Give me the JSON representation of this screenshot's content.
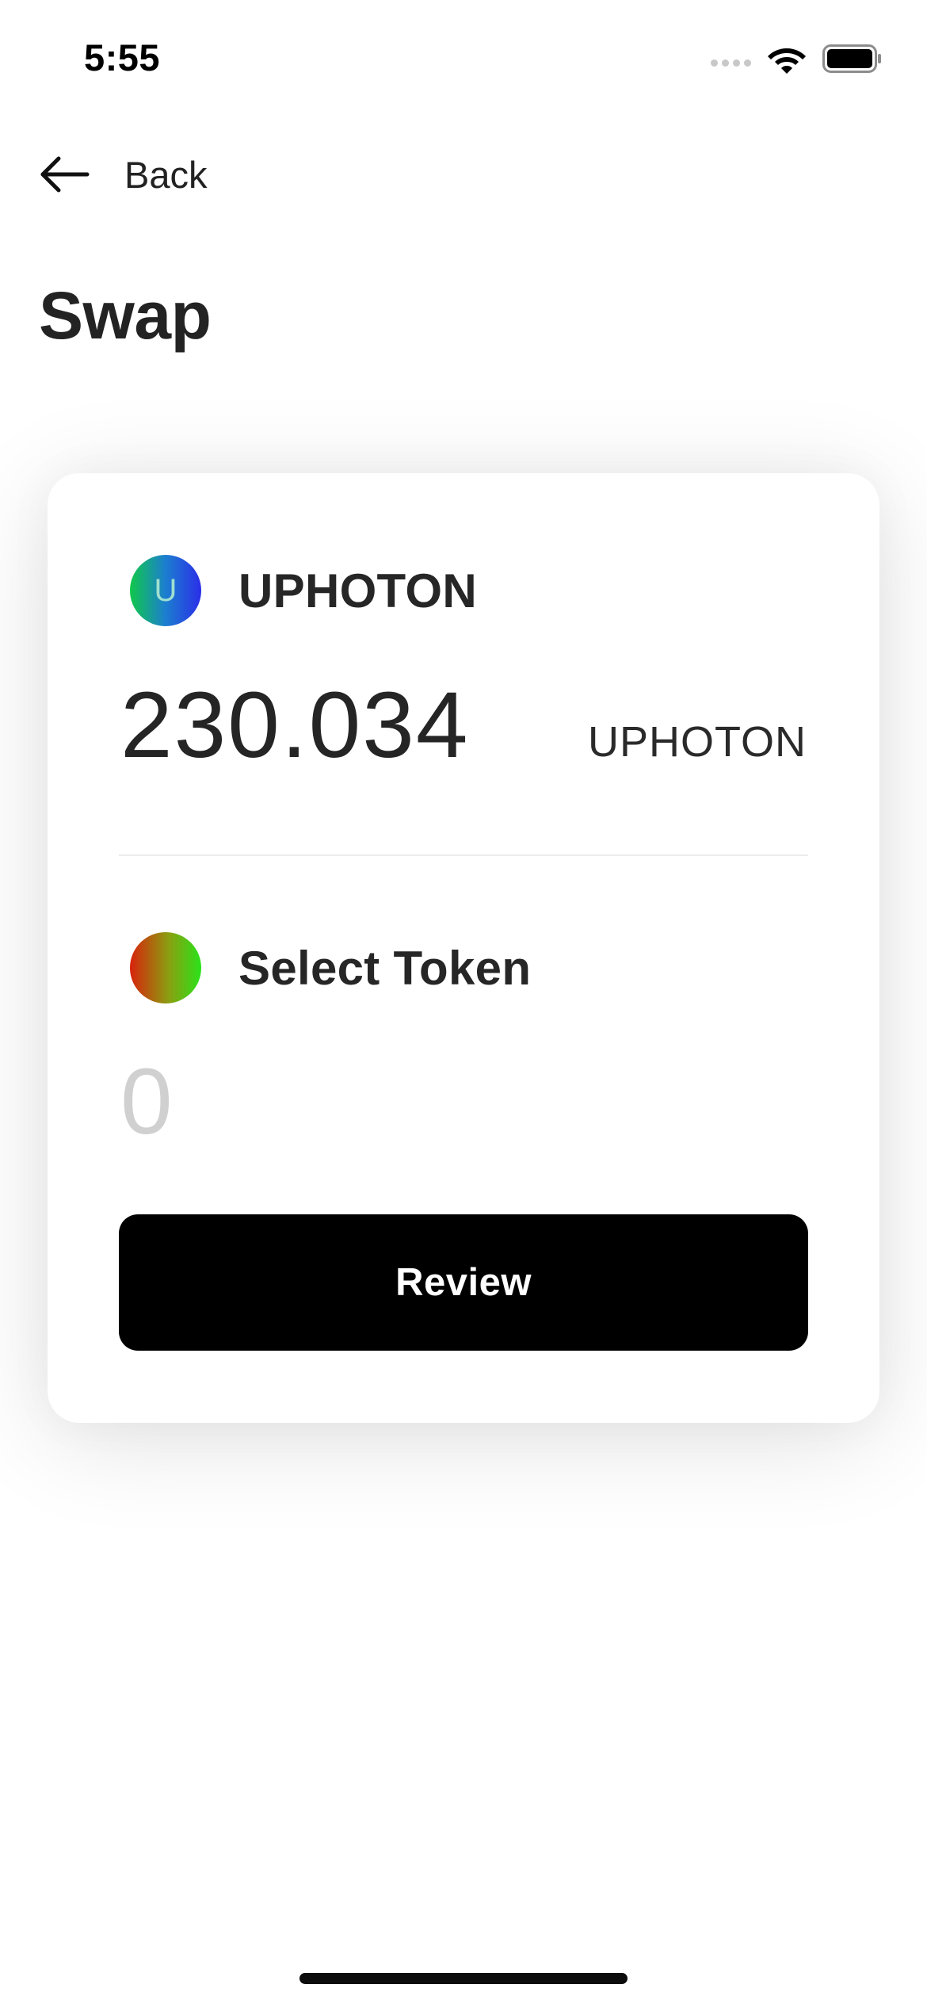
{
  "status_bar": {
    "time": "5:55",
    "icons": [
      "signal-icon",
      "wifi-icon",
      "battery-icon"
    ]
  },
  "nav": {
    "back_label": "Back",
    "back_icon": "arrow-left-icon"
  },
  "page": {
    "title": "Swap"
  },
  "swap": {
    "from": {
      "token_initial": "U",
      "token_name": "UPHOTON",
      "amount": "230.034",
      "unit": "UPHOTON",
      "icon_colors": [
        "#10c84a",
        "#2a2ee8"
      ]
    },
    "to": {
      "token_name": "Select Token",
      "amount": "0",
      "icon_colors": [
        "#d8220c",
        "#2ae21a"
      ]
    },
    "review_label": "Review"
  },
  "colors": {
    "background": "#ffffff",
    "text": "#242424",
    "button": "#000000",
    "placeholder_amount": "#d0d0d0"
  }
}
